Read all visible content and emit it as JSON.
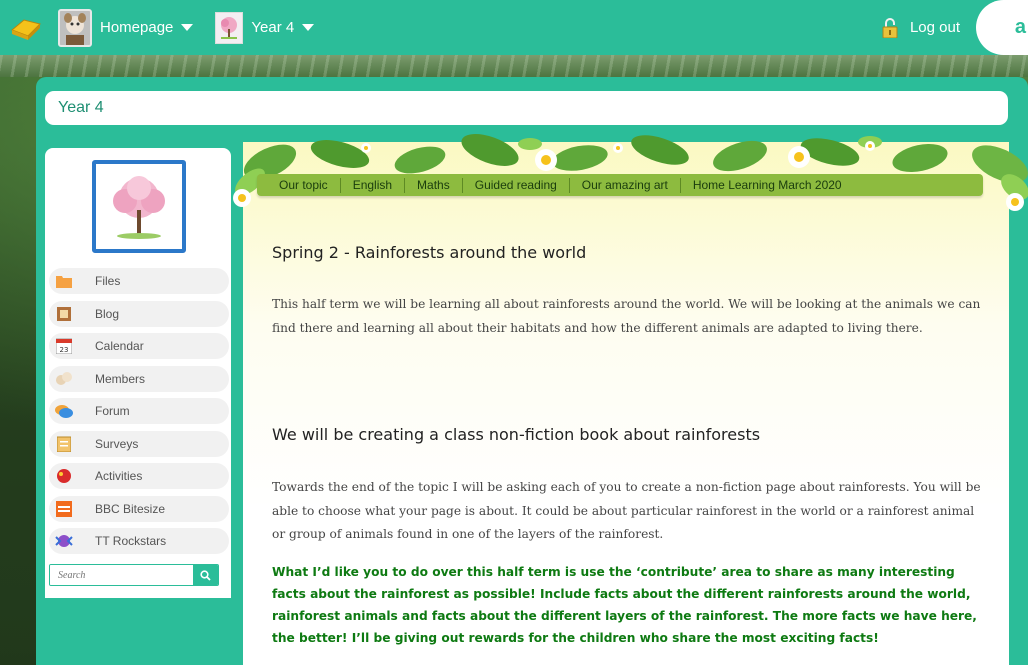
{
  "topbar": {
    "nav_homepage": "Homepage",
    "nav_class": "Year 4",
    "logout": "Log out",
    "brand": "a"
  },
  "title_bar": "Year 4",
  "sidebar": {
    "items": [
      {
        "label": "Files",
        "icon": "folder-icon"
      },
      {
        "label": "Blog",
        "icon": "blog-book-icon"
      },
      {
        "label": "Calendar",
        "icon": "calendar-icon",
        "icon_text": "23"
      },
      {
        "label": "Members",
        "icon": "members-icon"
      },
      {
        "label": "Forum",
        "icon": "forum-bubbles-icon"
      },
      {
        "label": "Surveys",
        "icon": "survey-clipboard-icon"
      },
      {
        "label": "Activities",
        "icon": "activities-icon"
      },
      {
        "label": "BBC Bitesize",
        "icon": "bbc-bitesize-icon"
      },
      {
        "label": "TT Rockstars",
        "icon": "tt-rockstars-icon"
      }
    ],
    "search_placeholder": "Search"
  },
  "tabs": [
    "Our topic",
    "English",
    "Maths",
    "Guided reading",
    "Our amazing art",
    "Home Learning March 2020"
  ],
  "content": {
    "heading1": "Spring 2 - Rainforests around the world",
    "para1": "This half term we will be learning all about rainforests around the world. We will be looking at the animals we can find there and learning all about their habitats and how the different animals are adapted to living there.",
    "heading2": "We will be creating a class non-fiction book about rainforests",
    "para2": "Towards the end of the topic I will be asking each of you to create a non-fiction page about rainforests. You will be able to choose what your page is about. It could be about particular rainforest in the world or a rainforest animal or group of animals found in one of the layers of the rainforest.",
    "para3": "What I’d like you to do over this half term is use the ‘contribute’ area to share as many interesting facts about the rainforest as possible! Include facts about the different rainforests around the world, rainforest animals and facts about the different layers of the rainforest. The more facts we have here, the better! I’ll be giving out rewards for the children who share the most exciting facts!"
  },
  "colors": {
    "teal": "#2bbd99",
    "tab_green": "#8dbb3f",
    "highlight_text": "#0e7a12"
  }
}
